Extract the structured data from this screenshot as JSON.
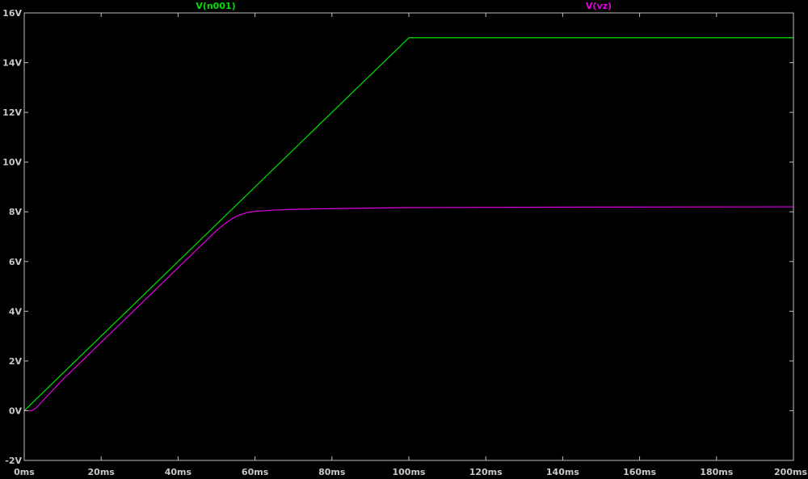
{
  "colors": {
    "background": "#000000",
    "frame": "#bfbfbf",
    "tick_label": "#c8c8c8"
  },
  "chart_data": {
    "type": "line",
    "grid": false,
    "x_unit": "ms",
    "y_unit": "V",
    "xlim": [
      0,
      200
    ],
    "ylim": [
      -2,
      16
    ],
    "x_ticks": [
      {
        "value": 0,
        "label": "0ms"
      },
      {
        "value": 20,
        "label": "20ms"
      },
      {
        "value": 40,
        "label": "40ms"
      },
      {
        "value": 60,
        "label": "60ms"
      },
      {
        "value": 80,
        "label": "80ms"
      },
      {
        "value": 100,
        "label": "100ms"
      },
      {
        "value": 120,
        "label": "120ms"
      },
      {
        "value": 140,
        "label": "140ms"
      },
      {
        "value": 160,
        "label": "160ms"
      },
      {
        "value": 180,
        "label": "180ms"
      },
      {
        "value": 200,
        "label": "200ms"
      }
    ],
    "y_ticks": [
      {
        "value": -2,
        "label": "-2V"
      },
      {
        "value": 0,
        "label": "0V"
      },
      {
        "value": 2,
        "label": "2V"
      },
      {
        "value": 4,
        "label": "4V"
      },
      {
        "value": 6,
        "label": "6V"
      },
      {
        "value": 8,
        "label": "8V"
      },
      {
        "value": 10,
        "label": "10V"
      },
      {
        "value": 12,
        "label": "12V"
      },
      {
        "value": 14,
        "label": "14V"
      },
      {
        "value": 16,
        "label": "16V"
      }
    ],
    "series": [
      {
        "name": "V(n001)",
        "color": "#00e000",
        "x": [
          0,
          100,
          200
        ],
        "y": [
          0,
          15,
          15
        ]
      },
      {
        "name": "V(vz)",
        "color": "#e000e0",
        "x": [
          0,
          2,
          3,
          10,
          20,
          30,
          40,
          50,
          52,
          54,
          56,
          58,
          60,
          65,
          70,
          80,
          90,
          100,
          120,
          150,
          200
        ],
        "y": [
          0,
          0,
          0.1,
          1.25,
          2.75,
          4.25,
          5.75,
          7.25,
          7.5,
          7.72,
          7.88,
          7.97,
          8.02,
          8.07,
          8.1,
          8.13,
          8.15,
          8.17,
          8.18,
          8.19,
          8.2
        ]
      }
    ]
  }
}
